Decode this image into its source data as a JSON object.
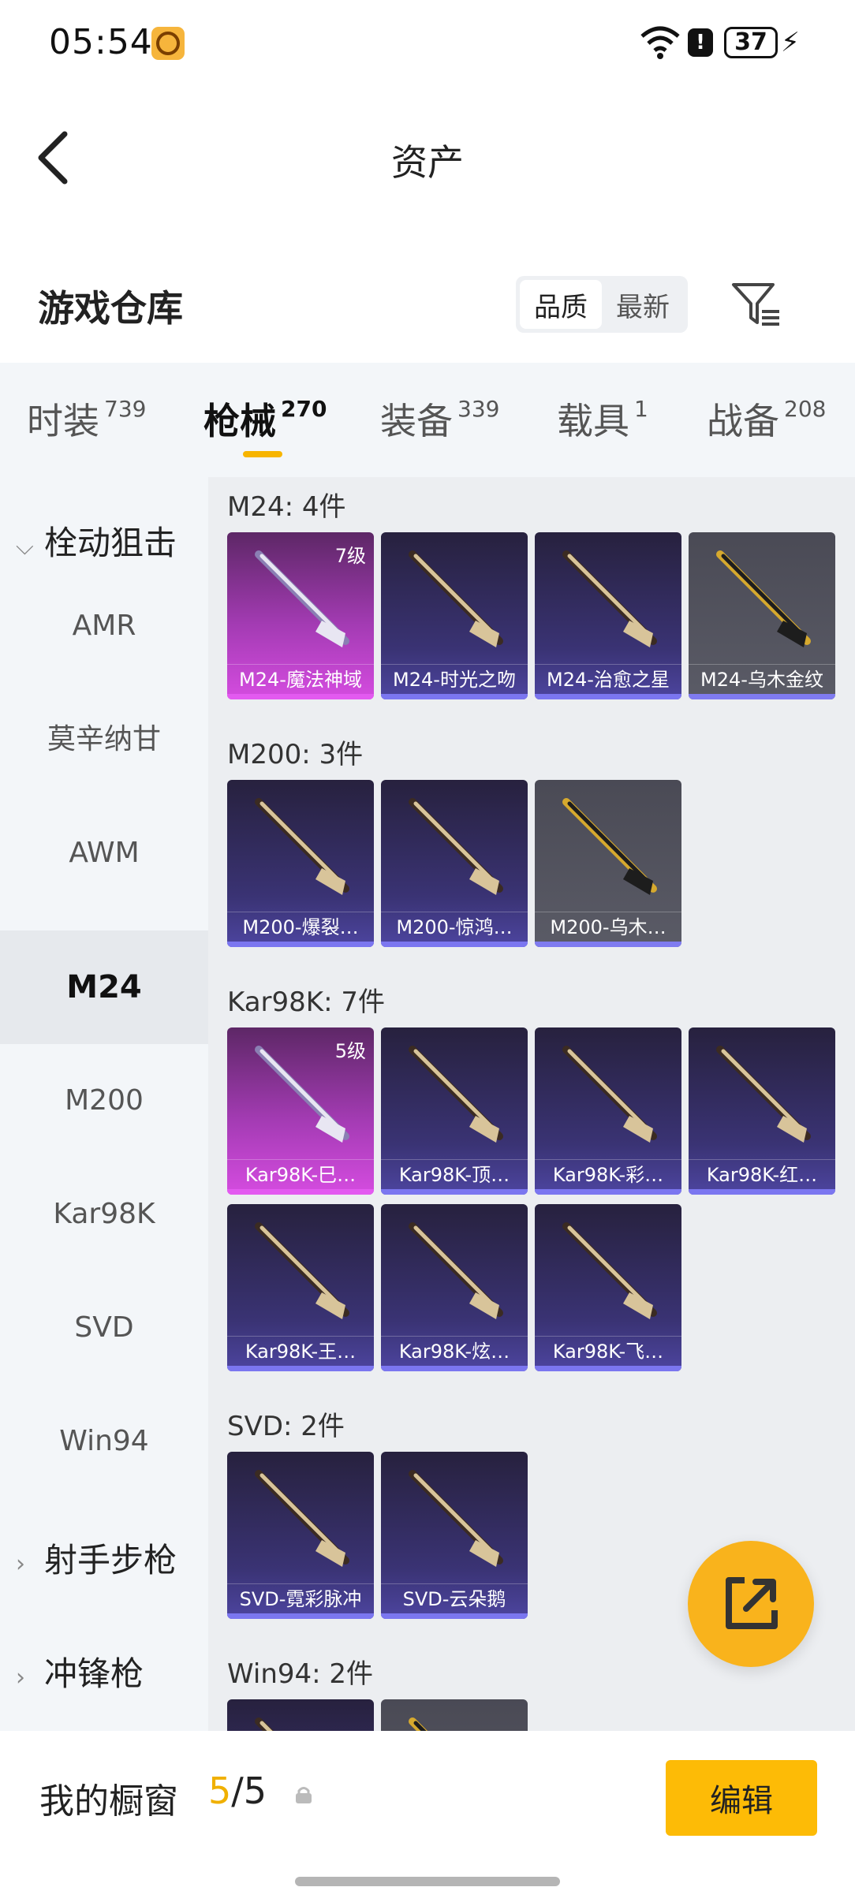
{
  "status_bar": {
    "time": "05:54",
    "battery": "37"
  },
  "header": {
    "title": "资产"
  },
  "warehouse": {
    "title": "游戏仓库",
    "sort_options": [
      "品质",
      "最新"
    ],
    "active_sort": "品质"
  },
  "tabs": [
    {
      "label": "时装",
      "count": "739"
    },
    {
      "label": "枪械",
      "count": "270"
    },
    {
      "label": "装备",
      "count": "339"
    },
    {
      "label": "载具",
      "count": "1"
    },
    {
      "label": "战备",
      "count": "208"
    }
  ],
  "active_tab": "枪械",
  "sidebar": {
    "group1": "栓动狙击",
    "items": [
      "AMR",
      "莫辛纳甘",
      "AWM",
      "M24",
      "M200",
      "Kar98K",
      "SVD",
      "Win94"
    ],
    "active_item": "M24",
    "group2": "射手步枪",
    "group3": "冲锋枪"
  },
  "sections": [
    {
      "title": "M24: 4件",
      "items": [
        {
          "name": "M24-魔法神域",
          "level": "7级",
          "style": "pink"
        },
        {
          "name": "M24-时光之吻",
          "style": "purple"
        },
        {
          "name": "M24-治愈之星",
          "style": "purple"
        },
        {
          "name": "M24-乌木金纹",
          "style": "gray"
        }
      ]
    },
    {
      "title": "M200: 3件",
      "items": [
        {
          "name": "M200-爆裂…",
          "style": "purple"
        },
        {
          "name": "M200-惊鸿…",
          "style": "purple"
        },
        {
          "name": "M200-乌木…",
          "style": "gray"
        }
      ]
    },
    {
      "title": "Kar98K: 7件",
      "items": [
        {
          "name": "Kar98K-巳…",
          "level": "5级",
          "style": "pink"
        },
        {
          "name": "Kar98K-顶…",
          "style": "purple"
        },
        {
          "name": "Kar98K-彩…",
          "style": "purple"
        },
        {
          "name": "Kar98K-红…",
          "style": "purple"
        },
        {
          "name": "Kar98K-王…",
          "style": "purple"
        },
        {
          "name": "Kar98K-炫…",
          "style": "purple"
        },
        {
          "name": "Kar98K-飞…",
          "style": "purple"
        }
      ]
    },
    {
      "title": "SVD: 2件",
      "items": [
        {
          "name": "SVD-霓彩脉冲",
          "style": "purple"
        },
        {
          "name": "SVD-云朵鹅",
          "style": "purple"
        }
      ]
    },
    {
      "title": "Win94: 2件",
      "items": [
        {
          "name": "",
          "style": "purple"
        },
        {
          "name": "",
          "style": "gray"
        }
      ]
    }
  ],
  "showcase": {
    "label": "我的橱窗",
    "current": "5",
    "total": "/5",
    "edit_label": "编辑"
  },
  "colors": {
    "accent": "#fdbb06",
    "pink_card": "#d54ce0",
    "purple_card": "#4d45a0",
    "gray_card": "#5a5b66"
  }
}
